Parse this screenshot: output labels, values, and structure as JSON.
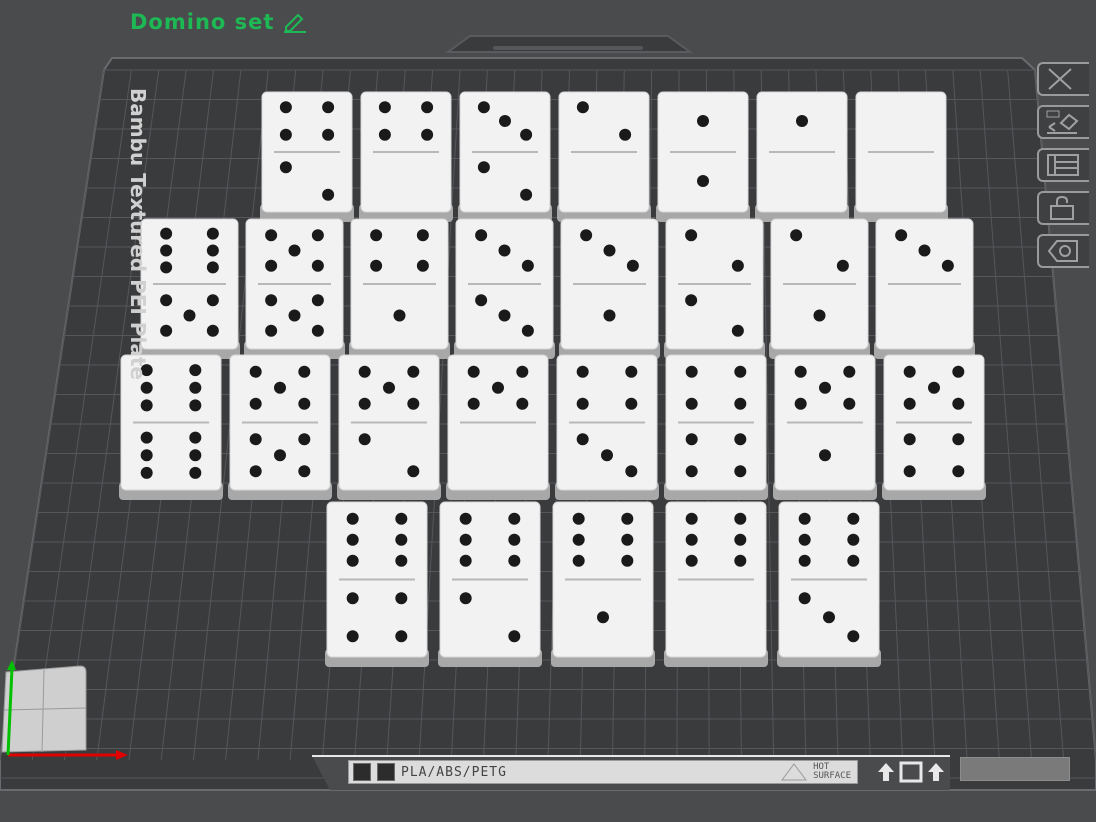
{
  "header": {
    "project_name": "Domino set"
  },
  "plate": {
    "name": "Bambu Textured PEI Plate",
    "material": "PLA/ABS/PETG",
    "warning_line1": "HOT",
    "warning_line2": "SURFACE"
  },
  "toolbar": {
    "items": [
      {
        "name": "close-icon"
      },
      {
        "name": "auto-orient-icon"
      },
      {
        "name": "arrange-icon"
      },
      {
        "name": "lock-icon"
      },
      {
        "name": "plate-settings-icon"
      }
    ]
  },
  "dominoes": [
    [
      [
        4,
        2
      ],
      [
        4,
        0
      ],
      [
        3,
        2
      ],
      [
        2,
        0
      ],
      [
        1,
        1
      ],
      [
        1,
        0
      ],
      [
        0,
        0
      ]
    ],
    [
      [
        6,
        5
      ],
      [
        5,
        5
      ],
      [
        4,
        1
      ],
      [
        3,
        3
      ],
      [
        3,
        1
      ],
      [
        2,
        2
      ],
      [
        2,
        1
      ],
      [
        3,
        0
      ]
    ],
    [
      [
        6,
        6
      ],
      [
        5,
        5
      ],
      [
        5,
        2
      ],
      [
        5,
        0
      ],
      [
        4,
        3
      ],
      [
        4,
        4
      ],
      [
        5,
        1
      ],
      [
        5,
        4
      ]
    ],
    [
      [
        6,
        4
      ],
      [
        6,
        2
      ],
      [
        6,
        1
      ],
      [
        6,
        0
      ],
      [
        6,
        3
      ]
    ]
  ],
  "colors": {
    "background": "#4a4b4d",
    "plate": "#3a3b3d",
    "grid": "#55575a",
    "domino": "#f2f2f2",
    "pip": "#1a1a1a",
    "accent": "#1db954",
    "axis_x": "#e00000",
    "axis_y": "#00c000"
  }
}
